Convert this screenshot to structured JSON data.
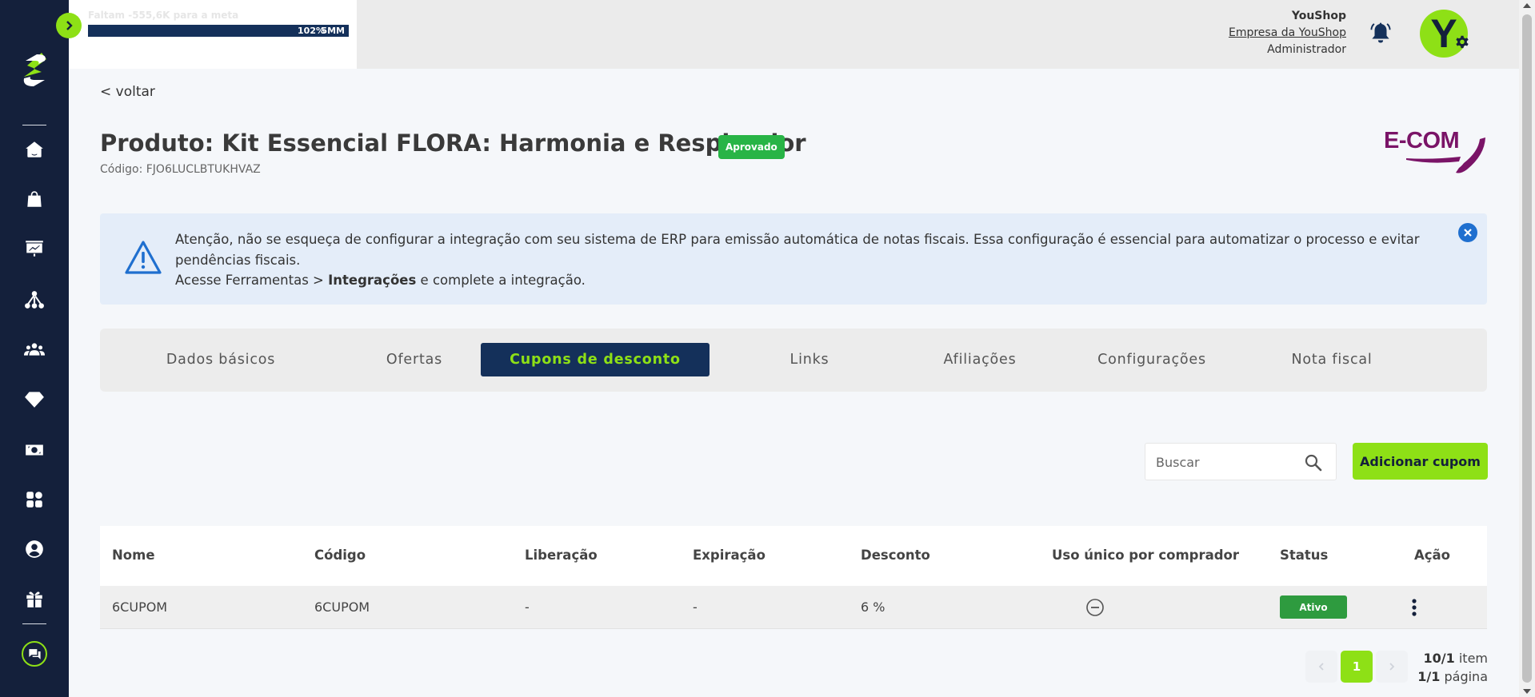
{
  "goal": {
    "text": "Faltam -555,6K para a meta",
    "percent": "102%",
    "target": "5MM"
  },
  "header": {
    "shop_name": "YouShop",
    "company": "Empresa da YouShop",
    "role": "Administrador",
    "avatar_letter": "Y"
  },
  "page": {
    "back": "< voltar",
    "title": "Produto: Kit Essencial FLORA: Harmonia e Resplendor",
    "status": "Aprovado",
    "code": "Código: FJO6LUCLBTUKHVAZ",
    "brand": "E-COM"
  },
  "alert": {
    "line1": "Atenção, não se esqueça de configurar a integração com seu sistema de ERP para emissão automática de notas fiscais. Essa configuração é essencial para automatizar o processo e evitar pendências fiscais.",
    "line2_prefix": "Acesse Ferramentas > ",
    "line2_bold": "Integrações",
    "line2_suffix": " e complete a integração."
  },
  "tabs": [
    {
      "label": "Dados básicos"
    },
    {
      "label": "Ofertas"
    },
    {
      "label": "Cupons de desconto"
    },
    {
      "label": "Links"
    },
    {
      "label": "Afiliações"
    },
    {
      "label": "Configurações"
    },
    {
      "label": "Nota fiscal"
    }
  ],
  "active_tab": "Cupons de desconto",
  "search": {
    "placeholder": "Buscar",
    "value": ""
  },
  "add_button": "Adicionar cupom",
  "table": {
    "columns": [
      "Nome",
      "Código",
      "Liberação",
      "Expiração",
      "Desconto",
      "Uso único por comprador",
      "Status",
      "Ação"
    ],
    "rows": [
      {
        "nome": "6CUPOM",
        "codigo": "6CUPOM",
        "liberacao": "-",
        "expiracao": "-",
        "desconto": "6 %",
        "status": "Ativo"
      }
    ]
  },
  "pagination": {
    "current": "1",
    "items_count": "10/1",
    "items_label": " item",
    "pages_count": "1/1",
    "pages_label": " página"
  },
  "colors": {
    "sidebar": "#14203b",
    "accent": "#8ee016",
    "navy": "#14305a",
    "approved": "#28b446",
    "active": "#2e9b3f",
    "alert_bg": "#e4edf9",
    "alert_icon": "#1f6fcf",
    "brand": "#7a1467"
  },
  "icons": {
    "sidebar": [
      "home-icon",
      "shopping-bag-icon",
      "presentation-chart-icon",
      "affiliate-network-icon",
      "team-icon",
      "diamond-icon",
      "money-icon",
      "apps-grid-icon",
      "user-circle-icon",
      "gift-icon",
      "chat-icon"
    ]
  }
}
